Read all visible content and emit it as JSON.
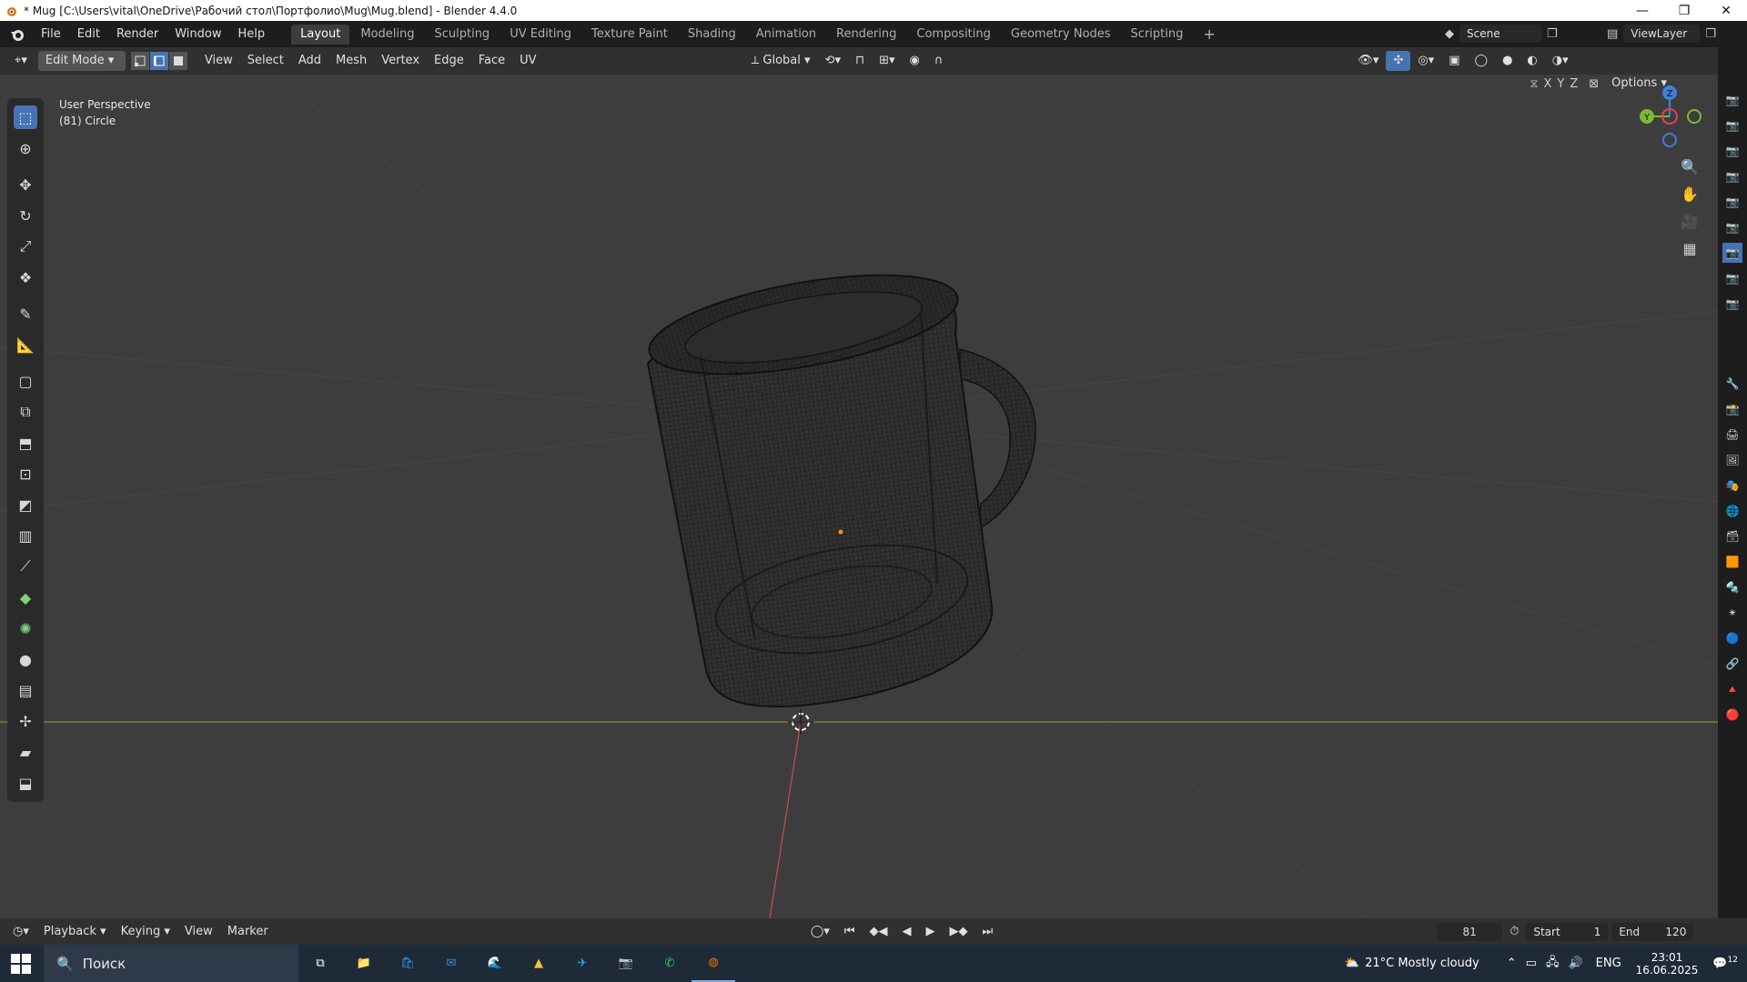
{
  "window": {
    "title": "* Mug [C:\\Users\\vital\\OneDrive\\Рабочий стол\\Портфолио\\Mug\\Mug.blend] - Blender 4.4.0",
    "minimize": "—",
    "maximize": "❐",
    "close": "✕"
  },
  "menu": [
    "File",
    "Edit",
    "Render",
    "Window",
    "Help"
  ],
  "workspaces": {
    "active": "Layout",
    "tabs": [
      "Layout",
      "Modeling",
      "Sculpting",
      "UV Editing",
      "Texture Paint",
      "Shading",
      "Animation",
      "Rendering",
      "Compositing",
      "Geometry Nodes",
      "Scripting"
    ],
    "add": "+"
  },
  "scene": {
    "name": "Scene",
    "view_layer": "ViewLayer"
  },
  "header": {
    "mode": "Edit Mode",
    "menus": [
      "View",
      "Select",
      "Add",
      "Mesh",
      "Vertex",
      "Edge",
      "Face",
      "UV"
    ],
    "transform_orientation": "Global",
    "options": "Options",
    "axes": [
      "X",
      "Y",
      "Z"
    ]
  },
  "viewport": {
    "perspective": "User Perspective",
    "object_info": "(81) Circle",
    "gizmo": {
      "z": "Z",
      "y": "Y",
      "x_color": "#e5404f",
      "y_color": "#7aba34",
      "z_color": "#3e7fd8"
    }
  },
  "tools": [
    "select-box",
    "cursor",
    "move",
    "rotate",
    "scale",
    "transform",
    "annotate",
    "measure",
    "add-cube",
    "extrude-region",
    "extrude-along-normals",
    "inset-faces",
    "bevel",
    "loop-cut",
    "knife",
    "poly-build",
    "spin",
    "smooth",
    "edge-slide",
    "shrink-fatten",
    "shear",
    "rip-region"
  ],
  "timeline": {
    "menus": [
      "Playback",
      "Keying",
      "View",
      "Marker"
    ],
    "current_frame": "81",
    "start_label": "Start",
    "start": "1",
    "end_label": "End",
    "end": "120"
  },
  "taskbar": {
    "search_placeholder": "Поиск",
    "weather": "21°C  Mostly cloudy",
    "language": "ENG",
    "time": "23:01",
    "date": "16.06.2025",
    "notifications": "12"
  },
  "colors": {
    "accent": "#4772b3",
    "viewport_bg": "#3d3d3d",
    "x_axis": "#c94d55",
    "y_axis": "#7d8f3a"
  }
}
